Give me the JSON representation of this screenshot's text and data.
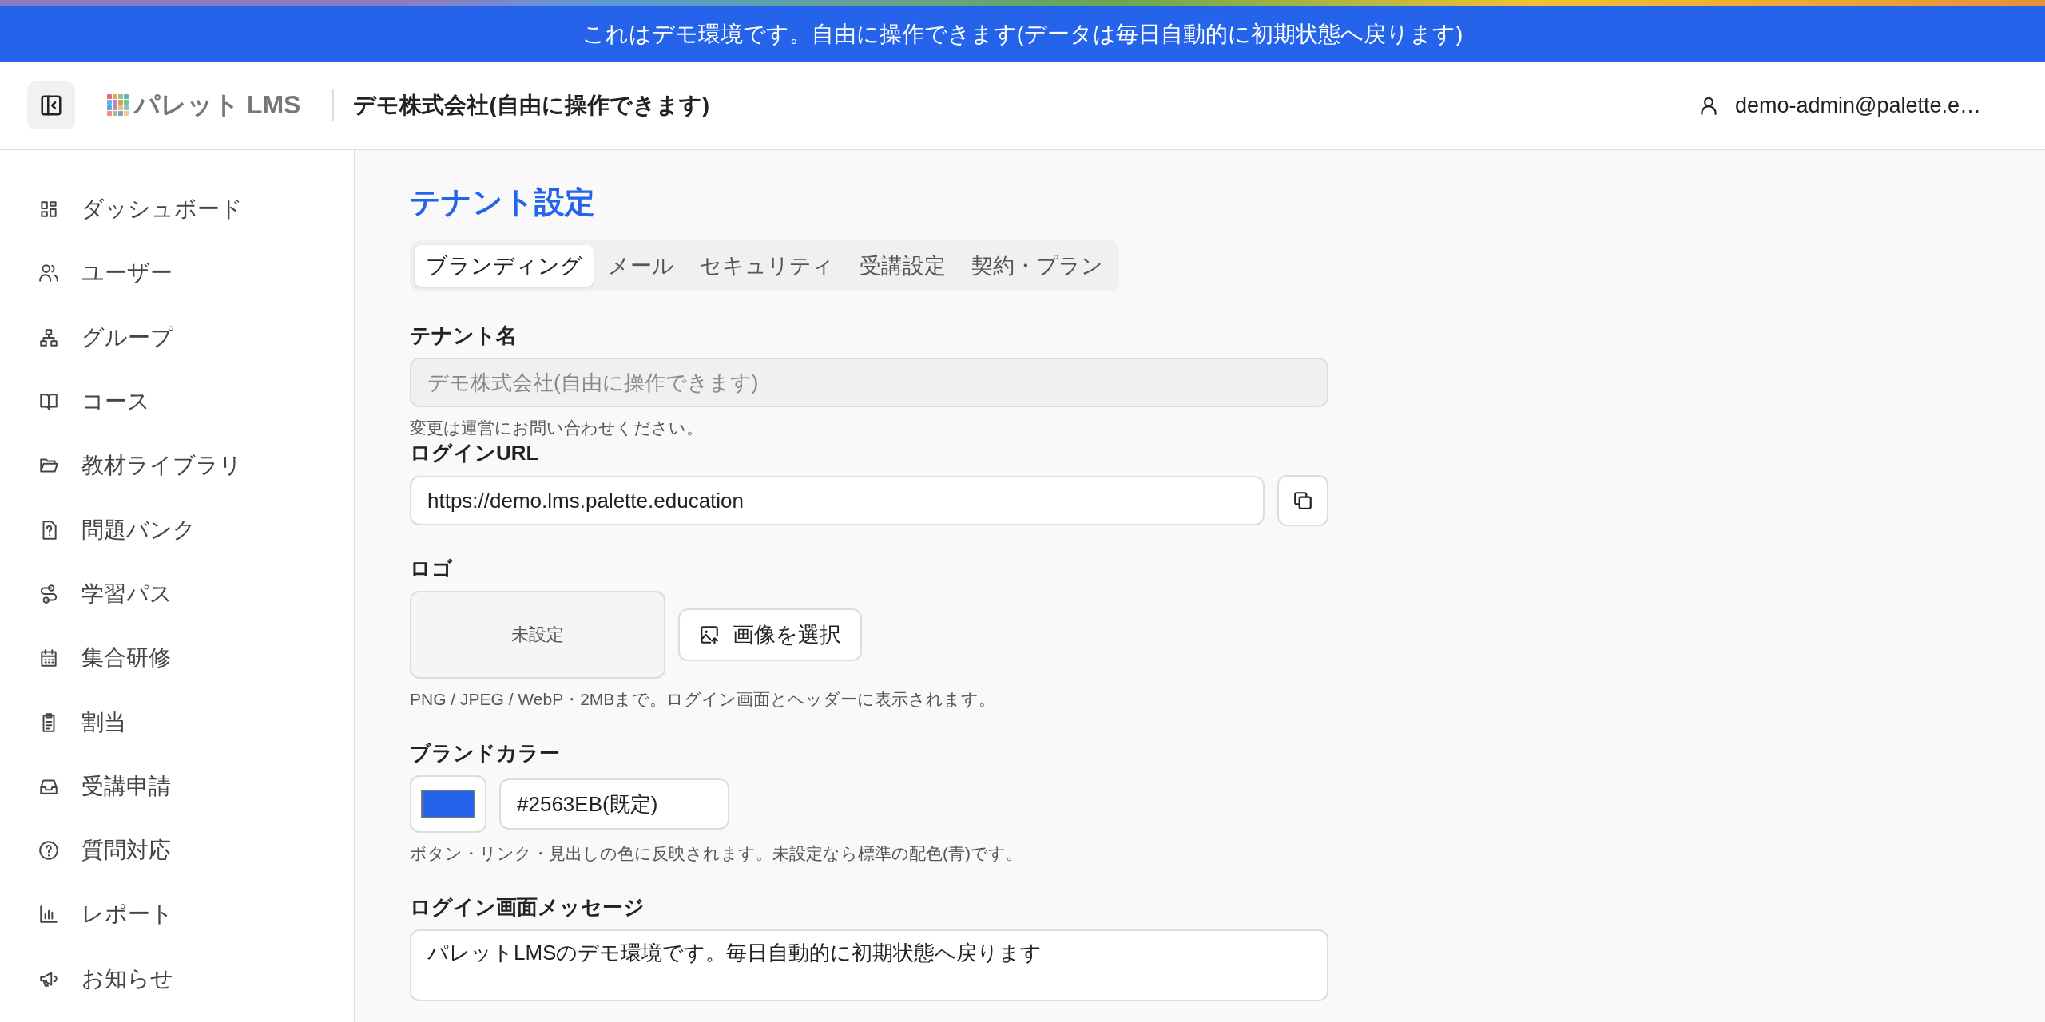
{
  "banner": {
    "text": "これはデモ環境です。自由に操作できます(データは毎日自動的に初期状態へ戻ります)"
  },
  "header": {
    "logo_text": "パレット LMS",
    "tenant": "デモ株式会社(自由に操作できます)",
    "user": "demo-admin@palette.e…"
  },
  "sidebar": {
    "items": [
      {
        "label": "ダッシュボード"
      },
      {
        "label": "ユーザー"
      },
      {
        "label": "グループ"
      },
      {
        "label": "コース"
      },
      {
        "label": "教材ライブラリ"
      },
      {
        "label": "問題バンク"
      },
      {
        "label": "学習パス"
      },
      {
        "label": "集合研修"
      },
      {
        "label": "割当"
      },
      {
        "label": "受講申請"
      },
      {
        "label": "質問対応"
      },
      {
        "label": "レポート"
      },
      {
        "label": "お知らせ"
      }
    ]
  },
  "page": {
    "title": "テナント設定",
    "tabs": [
      {
        "label": "ブランディング",
        "selected": true
      },
      {
        "label": "メール",
        "selected": false
      },
      {
        "label": "セキュリティ",
        "selected": false
      },
      {
        "label": "受講設定",
        "selected": false
      },
      {
        "label": "契約・プラン",
        "selected": false
      }
    ],
    "tenant_name": {
      "label": "テナント名",
      "value": "デモ株式会社(自由に操作できます)",
      "disabled": true,
      "help": "変更は運営にお問い合わせください。"
    },
    "login_url": {
      "label": "ログインURL",
      "value": "https://demo.lms.palette.education"
    },
    "logo": {
      "label": "ロゴ",
      "preview": "未設定",
      "button": "画像を選択",
      "help": "PNG / JPEG / WebP・2MBまで。ログイン画面とヘッダーに表示されます。"
    },
    "brand_color": {
      "label": "ブランドカラー",
      "color": "#2563eb",
      "value": "#2563EB(既定)",
      "help": "ボタン・リンク・見出しの色に反映されます。未設定なら標準の配色(青)です。"
    },
    "login_message": {
      "label": "ログイン画面メッセージ",
      "value": "パレットLMSのデモ環境です。毎日自動的に初期状態へ戻ります"
    }
  }
}
